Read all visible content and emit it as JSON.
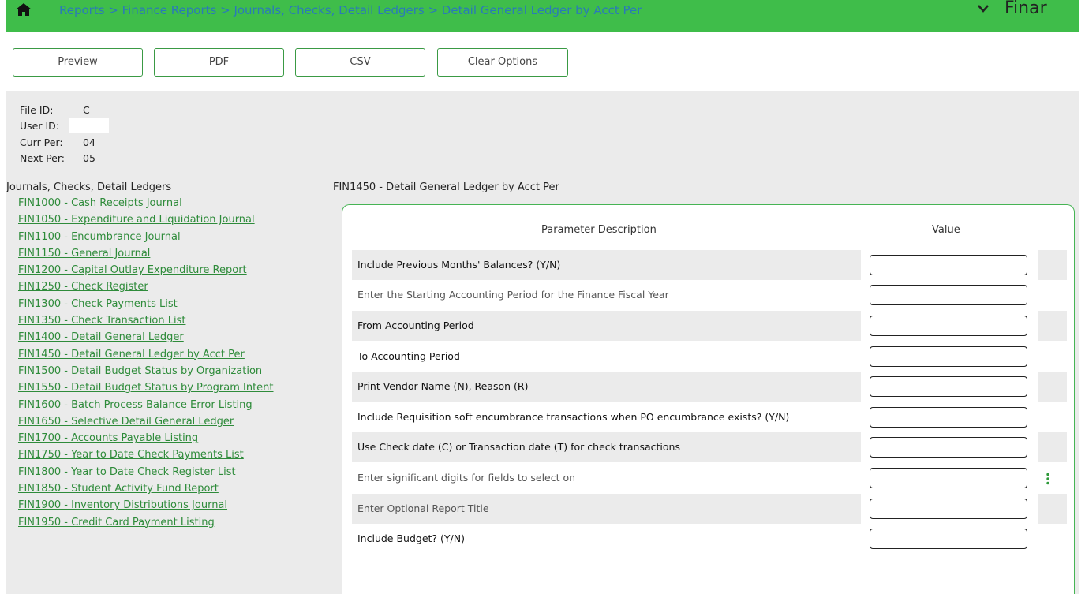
{
  "topbar": {
    "breadcrumb": "Reports > Finance Reports > Journals, Checks, Detail Ledgers > Detail General Ledger by Acct Per",
    "module_name": "Finar",
    "home_icon": "home-icon",
    "dropdown_icon": "chevron-down-icon",
    "bar_color": "#3fbd4a"
  },
  "toolbar": {
    "preview_label": "Preview",
    "pdf_label": "PDF",
    "csv_label": "CSV",
    "clear_label": "Clear Options"
  },
  "info": {
    "file_id_label": "File ID:",
    "file_id_value": "C",
    "user_id_label": "User ID:",
    "curr_per_label": "Curr Per:",
    "curr_per_value": "04",
    "next_per_label": "Next Per:",
    "next_per_value": "05"
  },
  "sidebar": {
    "heading": "Journals, Checks, Detail Ledgers",
    "items": [
      "FIN1000 - Cash Receipts Journal",
      "FIN1050 - Expenditure and Liquidation Journal",
      "FIN1100 - Encumbrance Journal",
      "FIN1150 - General Journal",
      "FIN1200 - Capital Outlay Expenditure Report",
      "FIN1250 - Check Register",
      "FIN1300 - Check Payments List",
      "FIN1350 - Check Transaction List",
      "FIN1400 - Detail General Ledger",
      "FIN1450 - Detail General Ledger by Acct Per",
      "FIN1500 - Detail Budget Status by Organization",
      "FIN1550 - Detail Budget Status by Program Intent",
      "FIN1600 - Batch Process Balance Error Listing",
      "FIN1650 - Selective Detail General Ledger",
      "FIN1700 - Accounts Payable Listing",
      "FIN1750 - Year to Date Check Payments List",
      "FIN1800 - Year to Date Check Register List",
      "FIN1850 - Student Activity Fund Report",
      "FIN1900 - Inventory Distributions Journal",
      "FIN1950 - Credit Card Payment Listing"
    ]
  },
  "form": {
    "title": "FIN1450 - Detail General Ledger by Acct Per",
    "col_param": "Parameter Description",
    "col_value": "Value",
    "params": [
      {
        "label": "Include Previous Months' Balances? (Y/N)",
        "value": ""
      },
      {
        "label": "Enter the Starting Accounting Period for the Finance Fiscal Year",
        "value": ""
      },
      {
        "label": "From Accounting Period",
        "value": ""
      },
      {
        "label": "To Accounting Period",
        "value": ""
      },
      {
        "label": "Print Vendor Name (N), Reason (R)",
        "value": ""
      },
      {
        "label": "Include Requisition soft encumbrance transactions when PO encumbrance exists? (Y/N)",
        "value": ""
      },
      {
        "label": "Use Check date (C) or Transaction date (T) for check transactions",
        "value": ""
      },
      {
        "label": "Enter significant digits for fields to select on",
        "value": ""
      },
      {
        "label": "Enter Optional Report Title",
        "value": ""
      },
      {
        "label": "Include Budget? (Y/N)",
        "value": ""
      }
    ],
    "kebab_icon": "kebab-menu-icon"
  }
}
